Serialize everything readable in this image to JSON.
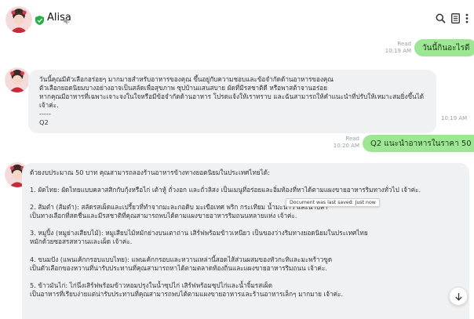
{
  "header": {
    "name": "Alisa",
    "avatar_icon": "girl-avatar-icon",
    "verified_icon": "green-shield-icon",
    "speaker_icon": "speaker-icon",
    "search_icon": "search-icon",
    "notes_icon": "notes-icon",
    "menu_icon": "more-vertical-icon"
  },
  "messages": [
    {
      "type": "outgoing",
      "text": "วันนี้กินอะไรดี",
      "status": "Read",
      "time": "10:19 AM"
    },
    {
      "type": "incoming",
      "lines": [
        "วันนี้คุณมีตัวเลือกอร่อยๆ มากมายสำหรับอาหารของคุณ ขึ้นอยู่กับความชอบและข้อจำกัดด้านอาหารของคุณ",
        "ตัวเลือกยอดนิยมบางอย่างอาจเป็นสลัดเพื่อสุขภาพ ซุปบ้านแสนสบาย ผัดที่มีรสชาติดี หรือพาสต้าจานอร่อย",
        "หากคุณมีอาหารที่เฉพาะเจาะจงในใจหรือมีข้อจำกัดด้านอาหาร โปรดแจ้งให้เราทราบ และฉันสามารถให้คำแนะนำที่ปรับให้เหมาะสมยิ่งขึ้นได้ เจ้าค่ะ.",
        "-----",
        "Q2"
      ],
      "time": "10:19 AM"
    },
    {
      "type": "outgoing",
      "text": "Q2 แนะนำอาหารในราคา 50 ยาท",
      "status": "Read",
      "time": "10:20 AM"
    },
    {
      "type": "incoming",
      "paragraphs": [
        [
          "ด้วยงบประมาณ 50 บาท คุณสามารถลองร้านอาหารข้างทางยอดนิยมในประเทศไทยได้:"
        ],
        [
          "1. ผัดไทย: ผัดไทยแบบคลาสสิกกับกุ้งหรือไก่ เต้าหู้ ถั่วงอก และถั่วลิสง เป็นเมนูที่อร่อยและอิ่มท้องที่หาได้ตามแผงขายอาหารริมทางทั่วไป เจ้าค่ะ."
        ],
        [
          "2. ส้มตำ (ส้มตำ): สลัดรสเผ็ดและเปรี้ยวที่ทำจากมะละกอดิบ มะเขือเทศ พริก กระเทียม น้ำมะนาว และน้ำปลา",
          "เป็นทางเลือกที่สดชื่นและมีรสชาติที่คุณสามารถพบได้ตามแผงขายอาหารริมถนนหลายแห่ง เจ้าค่ะ."
        ],
        [
          "3. หมูปิ้ง (หมูย่างเสียบไม้): หมูเสียบไม้หมักย่างบนเตาถ่าน เสิร์ฟพร้อมข้าวเหนียว เป็นของว่างริมทางยอดนิยมในประเทศไทย",
          "หมักด้วยซอสรสหวานและเผ็ด เจ้าค่ะ."
        ],
        [
          "4. ขนมปัง (แพนเค้กกรอบแบบไทย): แพนเค้กกรอบและหวานเหล่านี้สอดไส้ส่วนผสมของหัวกะทิและมะพร้าวขูด",
          "เป็นตัวเลือกของหวานที่น่ารับประทานที่คุณสามารถหาได้ตามตลาดท้องถิ่นและแผงขายอาหารริมถนน เจ้าค่ะ."
        ],
        [
          "5. ข้าวมันไก่: ไก่นึ่งเสิร์ฟพร้อมข้าวหอมปรุงในน้ำซุปไก่ เสิร์ฟพร้อมซุปไก่และน้ำจิ้มรสเผ็ด",
          "เป็นอาหารที่เรียบง่ายแต่น่ารับประทานที่คุณสามารถพบได้ตามแผงขายอาหารและร้านอาหารเล็กๆ มากมาย เจ้าค่ะ."
        ]
      ]
    }
  ],
  "tooltip": "Document was last saved: Just now",
  "scroll_down_icon": "arrow-down-icon",
  "colors": {
    "outgoing_bubble": "#9de693",
    "incoming_bubble": "#f0f1f2",
    "verified": "#1fb141"
  }
}
